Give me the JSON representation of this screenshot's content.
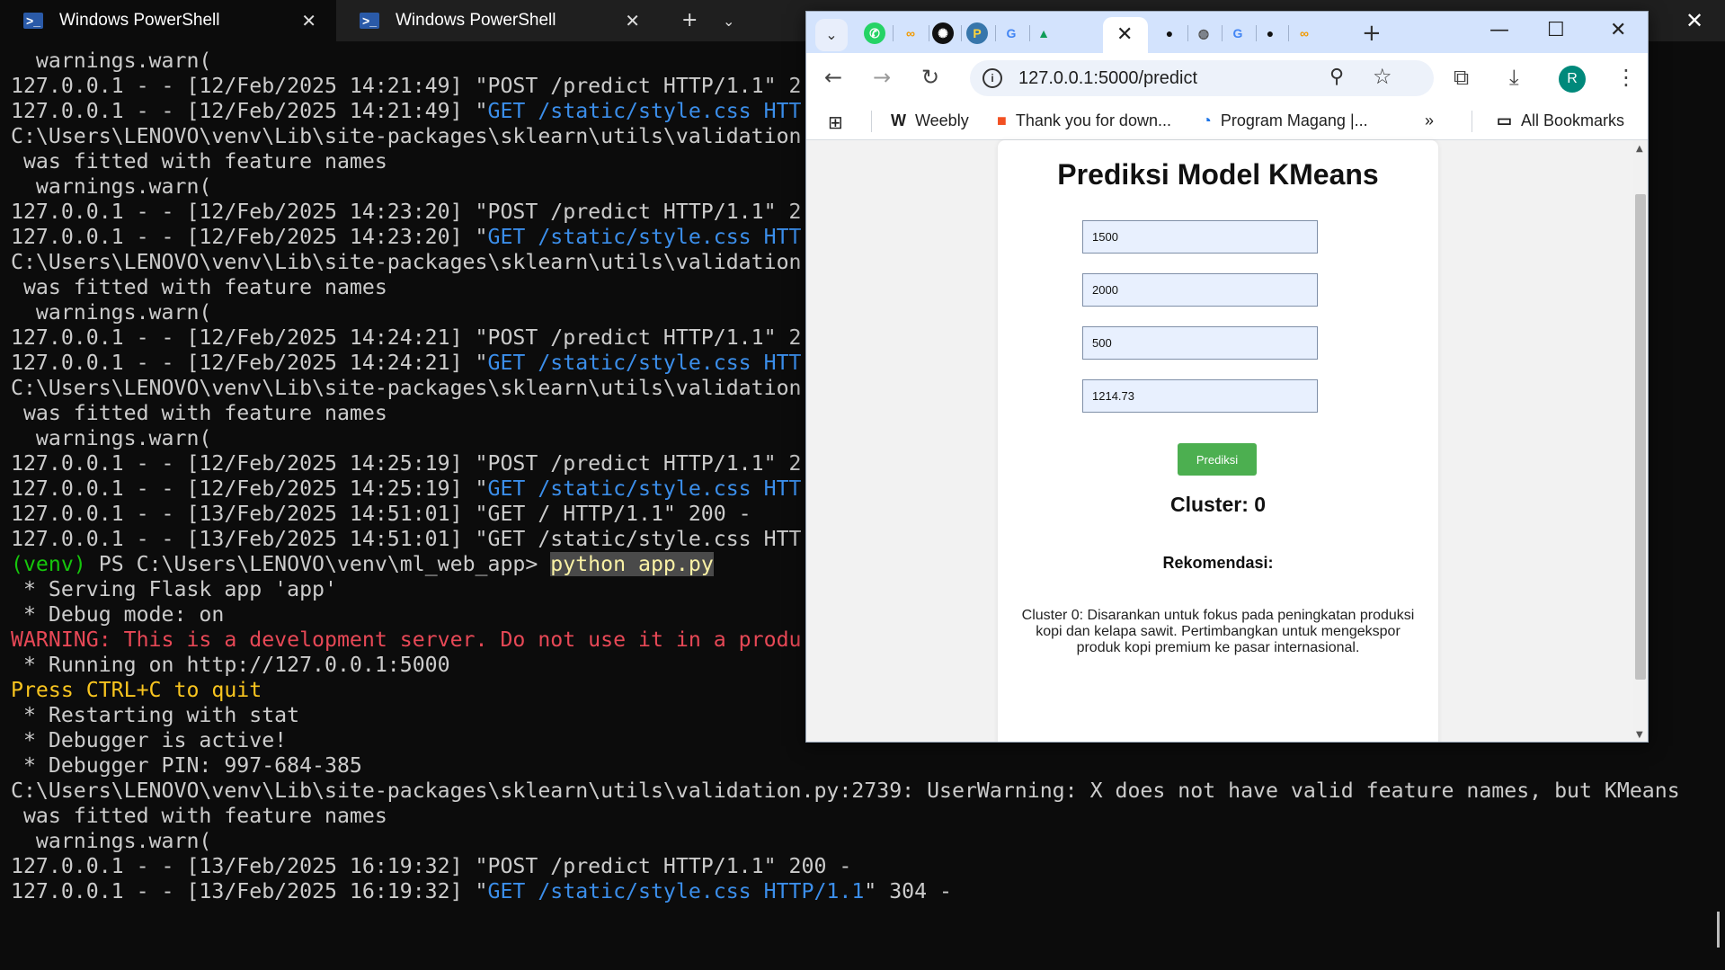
{
  "terminal": {
    "tabs": [
      {
        "title": "Windows PowerShell",
        "active": true
      },
      {
        "title": "Windows PowerShell",
        "active": false
      }
    ],
    "lines": [
      [
        {
          "t": "  warnings.warn("
        }
      ],
      [
        {
          "t": "127.0.0.1 - - [12/Feb/2025 14:21:49] \"POST /predict HTTP/1.1\" 2"
        }
      ],
      [
        {
          "t": "127.0.0.1 - - [12/Feb/2025 14:21:49] \""
        },
        {
          "t": "GET /static/style.css HTT",
          "c": "blue"
        }
      ],
      [
        {
          "t": "C:\\Users\\LENOVO\\venv\\Lib\\site-packages\\sklearn\\utils\\validation                                                  ans"
        }
      ],
      [
        {
          "t": " was fitted with feature names"
        }
      ],
      [
        {
          "t": "  warnings.warn("
        }
      ],
      [
        {
          "t": "127.0.0.1 - - [12/Feb/2025 14:23:20] \"POST /predict HTTP/1.1\" 2"
        }
      ],
      [
        {
          "t": "127.0.0.1 - - [12/Feb/2025 14:23:20] \""
        },
        {
          "t": "GET /static/style.css HTT",
          "c": "blue"
        }
      ],
      [
        {
          "t": "C:\\Users\\LENOVO\\venv\\Lib\\site-packages\\sklearn\\utils\\validation                                                  ans"
        }
      ],
      [
        {
          "t": " was fitted with feature names"
        }
      ],
      [
        {
          "t": "  warnings.warn("
        }
      ],
      [
        {
          "t": "127.0.0.1 - - [12/Feb/2025 14:24:21] \"POST /predict HTTP/1.1\" 2"
        }
      ],
      [
        {
          "t": "127.0.0.1 - - [12/Feb/2025 14:24:21] \""
        },
        {
          "t": "GET /static/style.css HTT",
          "c": "blue"
        }
      ],
      [
        {
          "t": "C:\\Users\\LENOVO\\venv\\Lib\\site-packages\\sklearn\\utils\\validation                                                  ans"
        }
      ],
      [
        {
          "t": " was fitted with feature names"
        }
      ],
      [
        {
          "t": "  warnings.warn("
        }
      ],
      [
        {
          "t": "127.0.0.1 - - [12/Feb/2025 14:25:19] \"POST /predict HTTP/1.1\" 2"
        }
      ],
      [
        {
          "t": "127.0.0.1 - - [12/Feb/2025 14:25:19] \""
        },
        {
          "t": "GET /static/style.css HTT",
          "c": "blue"
        }
      ],
      [
        {
          "t": "127.0.0.1 - - [13/Feb/2025 14:51:01] \"GET / HTTP/1.1\" 200 -"
        }
      ],
      [
        {
          "t": "127.0.0.1 - - [13/Feb/2025 14:51:01] \"GET /static/style.css HTT"
        }
      ],
      [
        {
          "t": "(venv) ",
          "c": "venv"
        },
        {
          "t": "PS C:\\Users\\LENOVO\\venv\\ml_web_app> "
        },
        {
          "t": "python app.py",
          "c": "hl"
        }
      ],
      [
        {
          "t": " * Serving Flask app 'app'"
        }
      ],
      [
        {
          "t": " * Debug mode: on"
        }
      ],
      [
        {
          "t": "WARNING: This is a development server. Do not use it in a produ",
          "c": "warn"
        }
      ],
      [
        {
          "t": " * Running on http://127.0.0.1:5000"
        }
      ],
      [
        {
          "t": "Press CTRL+C to quit",
          "c": "yellow"
        }
      ],
      [
        {
          "t": " * Restarting with stat"
        }
      ],
      [
        {
          "t": " * Debugger is active!"
        }
      ],
      [
        {
          "t": " * Debugger PIN: 997-684-385"
        }
      ],
      [
        {
          "t": "C:\\Users\\LENOVO\\venv\\Lib\\site-packages\\sklearn\\utils\\validation.py:2739: UserWarning: X does not have valid feature names, but KMeans"
        }
      ],
      [
        {
          "t": " was fitted with feature names"
        }
      ],
      [
        {
          "t": "  warnings.warn("
        }
      ],
      [
        {
          "t": "127.0.0.1 - - [13/Feb/2025 16:19:32] \"POST /predict HTTP/1.1\" 200 -"
        }
      ],
      [
        {
          "t": "127.0.0.1 - - [13/Feb/2025 16:19:32] \""
        },
        {
          "t": "GET /static/style.css HTTP/1.1",
          "c": "blue"
        },
        {
          "t": "\" 304 -"
        }
      ]
    ]
  },
  "browser": {
    "url": "127.0.0.1:5000/predict",
    "avatar_letter": "R",
    "bookmarks": {
      "weebly": "Weebly",
      "thank_you": "Thank you for down...",
      "magang": "Program Magang |...",
      "all": "All Bookmarks"
    }
  },
  "page": {
    "title": "Prediksi Model KMeans",
    "inputs": [
      "1500",
      "2000",
      "500",
      "1214.73"
    ],
    "button_label": "Prediksi",
    "cluster_text": "Cluster: 0",
    "recommendation_title": "Rekomendasi:",
    "recommendation_text": "Cluster 0: Disarankan untuk fokus pada peningkatan produksi kopi dan kelapa sawit. Pertimbangkan untuk mengekspor produk kopi premium ke pasar internasional."
  },
  "colors": {
    "terminal_bg": "#0c0c0c",
    "link_blue": "#3b8eea",
    "venv_green": "#16c60c",
    "warning_red": "#e74856",
    "press_yellow": "#f9c51f",
    "button_green": "#4caf50"
  }
}
